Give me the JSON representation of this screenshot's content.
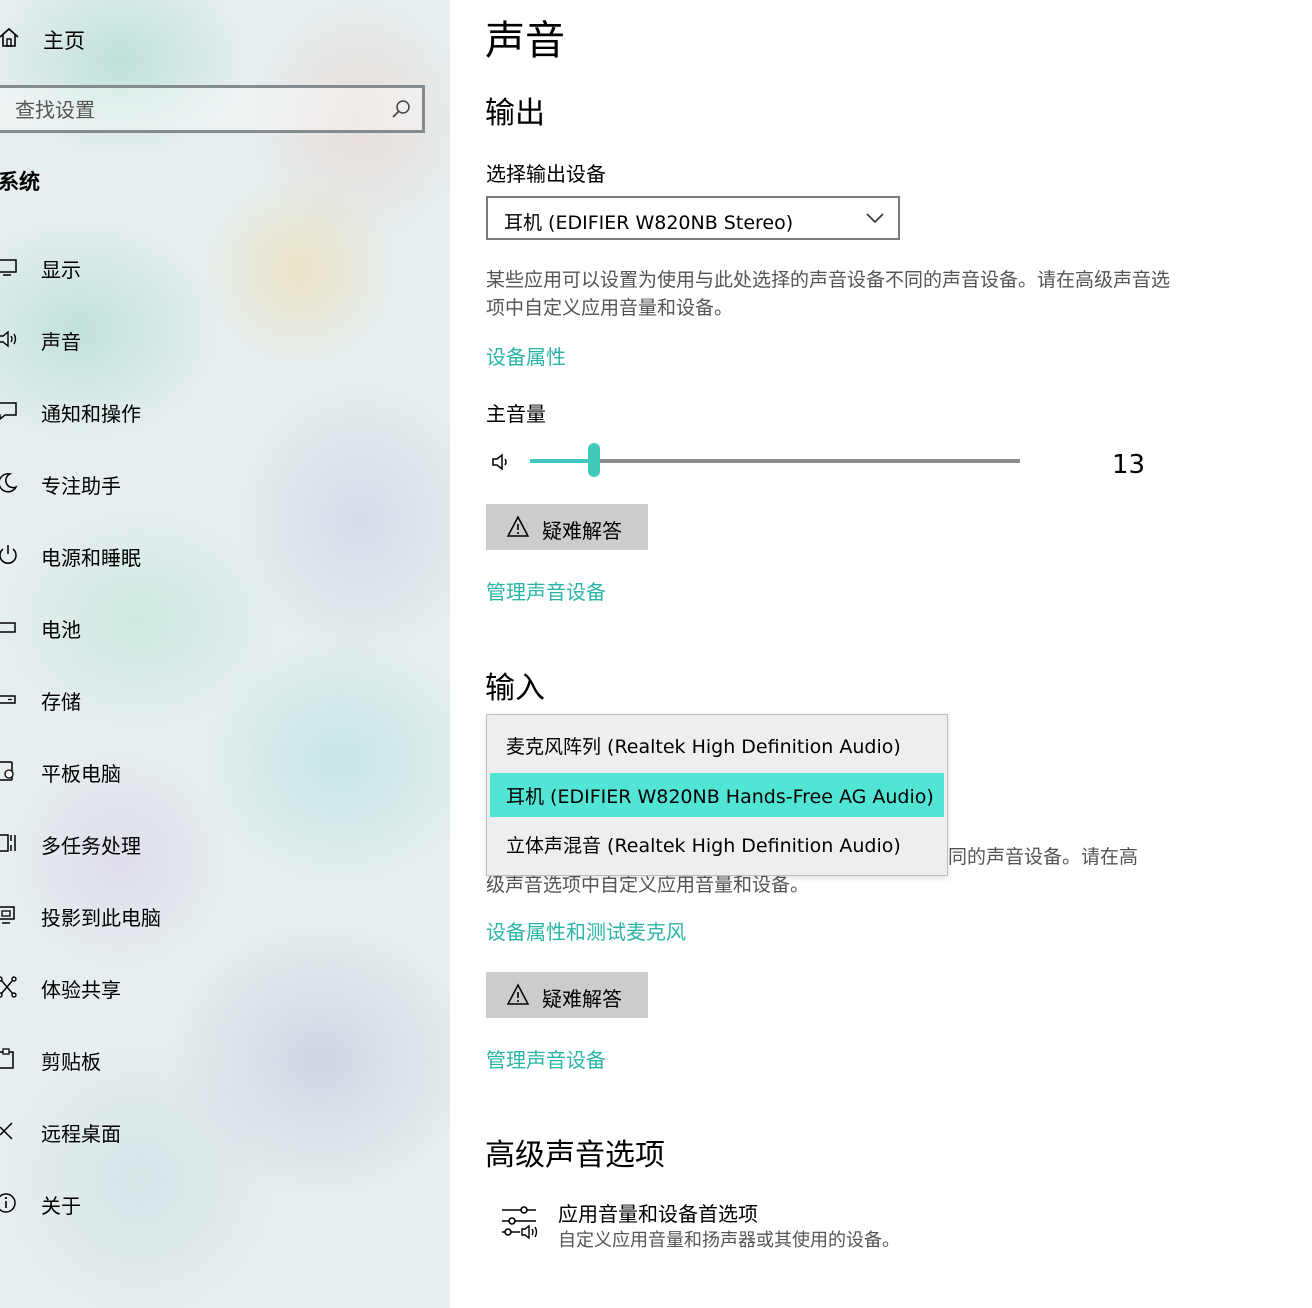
{
  "sidebar": {
    "home_label": "主页",
    "search_placeholder": "查找设置",
    "group_title": "系统",
    "items": [
      {
        "label": "显示",
        "icon": "display-icon"
      },
      {
        "label": "声音",
        "icon": "speaker-icon"
      },
      {
        "label": "通知和操作",
        "icon": "notification-icon"
      },
      {
        "label": "专注助手",
        "icon": "moon-icon"
      },
      {
        "label": "电源和睡眠",
        "icon": "power-icon"
      },
      {
        "label": "电池",
        "icon": "battery-icon"
      },
      {
        "label": "存储",
        "icon": "storage-icon"
      },
      {
        "label": "平板电脑",
        "icon": "tablet-icon"
      },
      {
        "label": "多任务处理",
        "icon": "multitask-icon"
      },
      {
        "label": "投影到此电脑",
        "icon": "project-icon"
      },
      {
        "label": "体验共享",
        "icon": "share-icon"
      },
      {
        "label": "剪贴板",
        "icon": "clipboard-icon"
      },
      {
        "label": "远程桌面",
        "icon": "remote-desktop-icon"
      },
      {
        "label": "关于",
        "icon": "info-icon"
      }
    ]
  },
  "main": {
    "title": "声音",
    "output": {
      "heading": "输出",
      "select_label": "选择输出设备",
      "selected_device": "耳机 (EDIFIER W820NB Stereo)",
      "description": "某些应用可以设置为使用与此处选择的声音设备不同的声音设备。请在高级声音选项中自定义应用音量和设备。",
      "device_properties_link": "设备属性",
      "volume_label": "主音量",
      "volume_value": "13",
      "volume_level": 13,
      "troubleshoot_label": "疑难解答",
      "manage_link": "管理声音设备"
    },
    "input": {
      "heading": "输入",
      "options": [
        "麦克风阵列 (Realtek High Definition Audio)",
        "耳机 (EDIFIER W820NB Hands-Free AG Audio)",
        "立体声混音 (Realtek High Definition Audio)"
      ],
      "selected_index": 1,
      "desc_line1_visible": "同的声音设备。请在高",
      "desc_line2_visible": "级声音选项中自定义应用音量和设备。",
      "device_properties_link": "设备属性和测试麦克风",
      "troubleshoot_label": "疑难解答",
      "manage_link": "管理声音设备"
    },
    "advanced": {
      "heading": "高级声音选项",
      "item_title": "应用音量和设备首选项",
      "item_desc": "自定义应用音量和扬声器或其使用的设备。"
    }
  },
  "colors": {
    "accent": "#3fc9bb",
    "link": "#2bb5a8",
    "selected_option": "#52e4d4",
    "button_bg": "#cccccc"
  }
}
